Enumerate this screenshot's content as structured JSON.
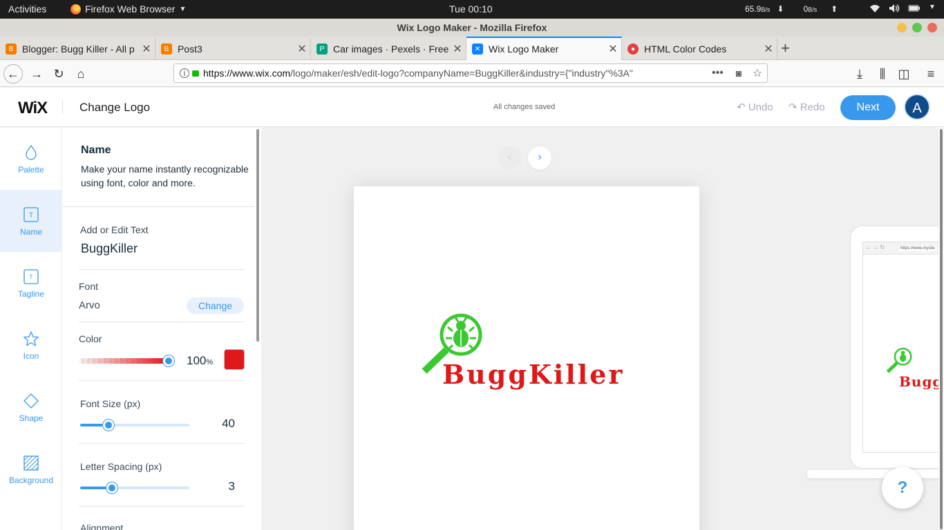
{
  "system_bar": {
    "activities": "Activities",
    "app_name": "Firefox Web Browser",
    "clock": "Tue 00:10",
    "net_down": "65.9",
    "net_down_unit": "B/s",
    "net_up": "0",
    "net_up_unit": "B/s"
  },
  "window": {
    "title": "Wix Logo Maker - Mozilla Firefox"
  },
  "tabs": [
    {
      "label": "Blogger: Bugg Killer - All p",
      "favicon": "blogger-icon",
      "color": "#f57d00"
    },
    {
      "label": "Post3",
      "favicon": "blogger-icon",
      "color": "#f57d00"
    },
    {
      "label": "Car images · Pexels · Free",
      "favicon": "pexels-icon",
      "color": "#05a081"
    },
    {
      "label": "Wix Logo Maker",
      "favicon": "wix-icon",
      "color": "#0a84ff",
      "active": true
    },
    {
      "label": "HTML Color Codes",
      "favicon": "colorcodes-icon",
      "color": "#e04040"
    }
  ],
  "address": {
    "host": "https://www.wix.com",
    "path": "/logo/maker/esh/edit-logo?companyName=BuggKiller&industry={\"industry\"%3A\""
  },
  "wix": {
    "logo": "WiX",
    "page_title": "Change Logo",
    "status": "All changes saved",
    "undo": "Undo",
    "redo": "Redo",
    "next": "Next",
    "avatar": "A"
  },
  "rail": [
    {
      "label": "Palette",
      "icon": "drop-icon"
    },
    {
      "label": "Name",
      "icon": "text-box-icon",
      "selected": true
    },
    {
      "label": "Tagline",
      "icon": "text-box-small-icon"
    },
    {
      "label": "Icon",
      "icon": "star-icon"
    },
    {
      "label": "Shape",
      "icon": "diamond-icon"
    },
    {
      "label": "Background",
      "icon": "hatched-square-icon"
    }
  ],
  "panel": {
    "title": "Name",
    "description": "Make your name instantly recognizable using font, color and more.",
    "text_label": "Add or Edit Text",
    "text_value": "BuggKiller",
    "font_label": "Font",
    "font_value": "Arvo",
    "font_change": "Change",
    "color_label": "Color",
    "color_opacity": "100",
    "color_opacity_unit": "%",
    "color_opacity_fraction": 1.0,
    "color_swatch": "#e01818",
    "font_size_label": "Font Size (px)",
    "font_size_value": "40",
    "font_size_fraction": 0.26,
    "letter_spacing_label": "Letter Spacing (px)",
    "letter_spacing_value": "3",
    "letter_spacing_fraction": 0.29,
    "alignment_label": "Alignment"
  },
  "preview": {
    "logo_text": "BuggKiller",
    "logo_color": "#e01818",
    "icon_color": "#3cc832",
    "icon": "bug-magnifier-icon",
    "laptop_url": "https://www.mysite",
    "laptop_logo_text": "Bugg"
  },
  "help": "?"
}
